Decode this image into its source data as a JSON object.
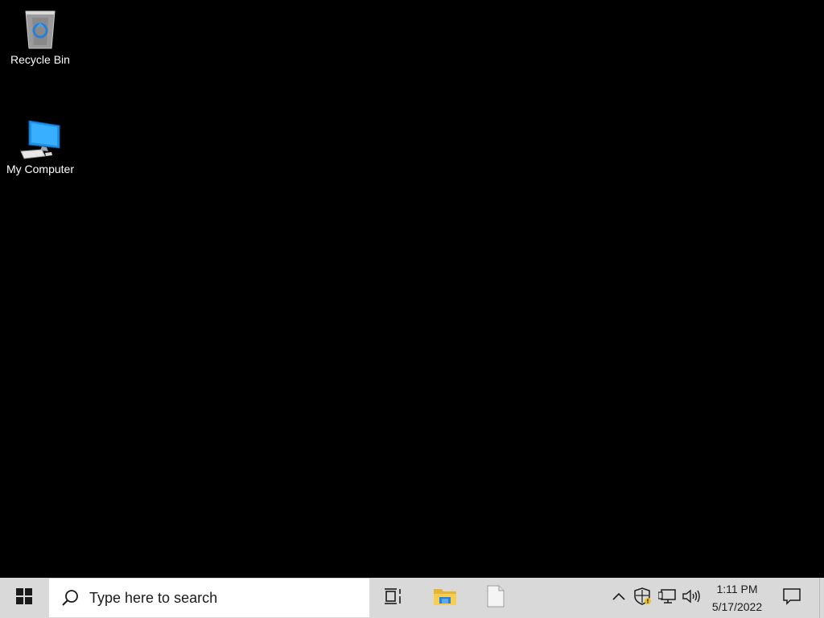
{
  "desktop": {
    "background": "#000000",
    "icons": [
      {
        "label": "Recycle Bin",
        "icon": "recycle-bin-icon"
      },
      {
        "label": "My Computer",
        "icon": "computer-icon"
      }
    ]
  },
  "taskbar": {
    "background": "#d9d9d9",
    "start_icon": "windows-logo-icon",
    "search": {
      "placeholder": "Type here to search",
      "icon": "search-icon"
    },
    "pinned": [
      {
        "name": "Task View",
        "icon": "task-view-icon"
      },
      {
        "name": "File Explorer",
        "icon": "folder-icon"
      },
      {
        "name": "Notepad",
        "icon": "document-icon"
      }
    ],
    "tray": {
      "icons": [
        "chevron-up-icon",
        "shield-icon",
        "network-icon",
        "volume-icon"
      ],
      "time": "1:11 PM",
      "date": "5/17/2022",
      "notification_icon": "notification-icon"
    }
  }
}
